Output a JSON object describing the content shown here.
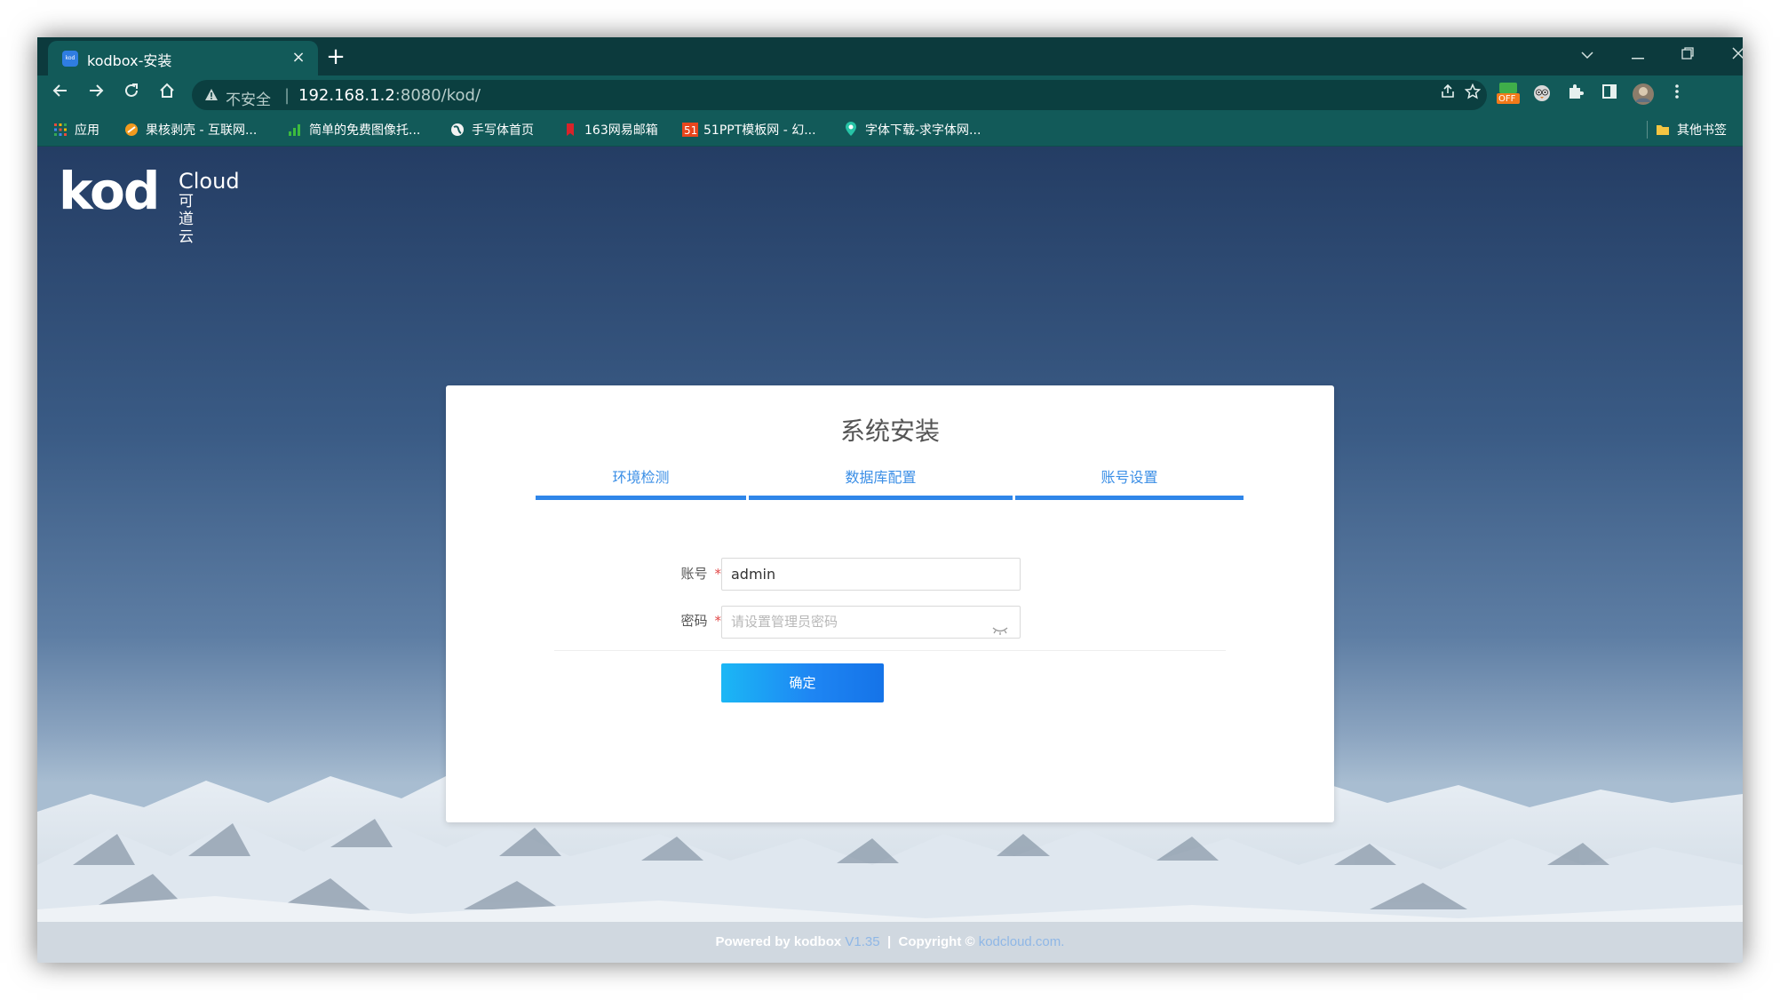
{
  "tab": {
    "title": "kodbox-安装",
    "favicon": "kod",
    "close": "×"
  },
  "new_tab": "+",
  "window_controls": {
    "dropdown": "⌵",
    "minimize": "—",
    "restore": "❐",
    "close": "✕"
  },
  "address": {
    "insecure_label": "不安全",
    "separator": "|",
    "host": "192.168.1.2",
    "path": ":8080/kod/"
  },
  "extension_badge": "OFF",
  "bookmarks": [
    {
      "label": "应用",
      "icon": "apps-grid-icon"
    },
    {
      "label": "果核剥壳 - 互联网...",
      "icon": "orange-icon"
    },
    {
      "label": "简单的免费图像托...",
      "icon": "bars-icon"
    },
    {
      "label": "手写体首页",
      "icon": "globe-icon"
    },
    {
      "label": "163网易邮箱",
      "icon": "red-tag-icon"
    },
    {
      "label": "51PPT模板网 - 幻...",
      "icon": "51-icon"
    },
    {
      "label": "字体下载-求字体网...",
      "icon": "pin-icon"
    },
    {
      "label": "其他书签",
      "icon": "folder-icon"
    }
  ],
  "logo": {
    "kod": "kod",
    "cloud": "Cloud",
    "cn": "可道云"
  },
  "install": {
    "title": "系统安装",
    "steps": [
      "环境检测",
      "数据库配置",
      "账号设置"
    ],
    "account_label": "账号",
    "account_value": "admin",
    "password_label": "密码",
    "password_placeholder": "请设置管理员密码",
    "required_mark": "*",
    "confirm_label": "确定"
  },
  "footer": {
    "powered": "Powered by kodbox",
    "version": "V1.35",
    "sep": "|",
    "copyright": "Copyright ©",
    "link": "kodcloud.com",
    "dot": "."
  },
  "colors": {
    "accent": "#2f86e9",
    "toolbar": "#125a59",
    "tabstrip": "#0c3a3d"
  }
}
